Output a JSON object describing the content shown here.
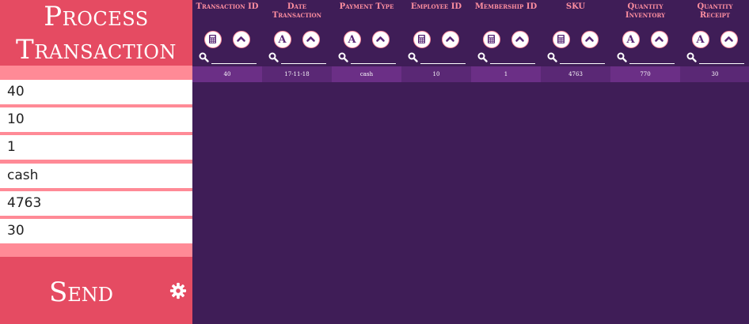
{
  "form": {
    "title_line1": "Process",
    "title_line2": "Transaction",
    "fields": [
      "40",
      "10",
      "1",
      "cash",
      "4763",
      "30"
    ],
    "send_label": "Send"
  },
  "table": {
    "headers": [
      {
        "line1": "Transaction ID",
        "line2": "",
        "filter_icon": "calculator-icon"
      },
      {
        "line1": "Date",
        "line2": "Transaction",
        "filter_icon": "text-a-icon"
      },
      {
        "line1": "Payment Type",
        "line2": "",
        "filter_icon": "text-a-icon"
      },
      {
        "line1": "Employee ID",
        "line2": "",
        "filter_icon": "calculator-icon"
      },
      {
        "line1": "Membership ID",
        "line2": "",
        "filter_icon": "calculator-icon"
      },
      {
        "line1": "SKU",
        "line2": "",
        "filter_icon": "calculator-icon"
      },
      {
        "line1": "Quantity",
        "line2": "Inventory",
        "filter_icon": "text-a-icon"
      },
      {
        "line1": "Quantity",
        "line2": "Receipt",
        "filter_icon": "text-a-icon"
      }
    ],
    "row": [
      "40",
      "17-11-18",
      "cash",
      "10",
      "1",
      "4763",
      "770",
      "30"
    ]
  },
  "colors": {
    "background": "#3f1d57",
    "brand": "#e54b62",
    "accent": "#ff8a96",
    "header_text": "#ff8fa0",
    "row_a": "#6b2f86",
    "row_b": "#5a2875"
  }
}
